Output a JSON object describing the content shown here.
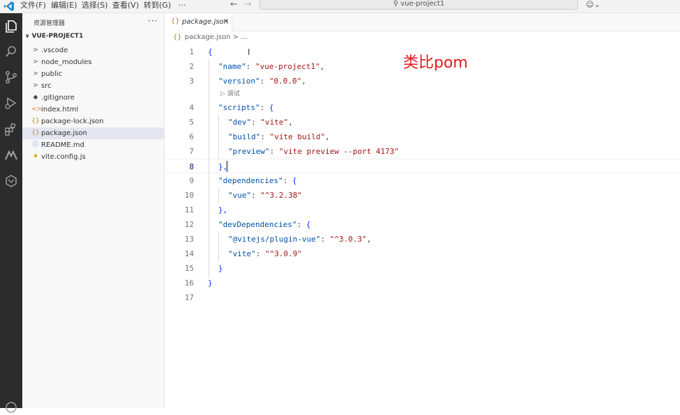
{
  "menu": {
    "items": [
      "文件(F)",
      "编辑(E)",
      "选择(S)",
      "查看(V)",
      "转到(G)",
      "···"
    ]
  },
  "search": {
    "text": "vue-project1"
  },
  "sidebar": {
    "title": "资源管理器",
    "more": "···",
    "project": "VUE-PROJECT1",
    "items": [
      {
        "icon": ">",
        "label": ".vscode"
      },
      {
        "icon": ">",
        "label": "node_modules"
      },
      {
        "icon": ">",
        "label": "public"
      },
      {
        "icon": ">",
        "label": "src"
      },
      {
        "icon": "◆",
        "label": ".gitignore"
      },
      {
        "icon": "<>",
        "label": "index.html"
      },
      {
        "icon": "{}",
        "label": "package-lock.json"
      },
      {
        "icon": "{}",
        "label": "package.json"
      },
      {
        "icon": "ⓘ",
        "label": "README.md"
      },
      {
        "icon": "♦",
        "label": "vite.config.js"
      }
    ]
  },
  "tab": {
    "label": "package.json",
    "icon": "{}",
    "close": "×"
  },
  "breadcrumb": {
    "file": "package.json",
    "rest": "…",
    "sep": ">"
  },
  "editor": {
    "line_numbers": [
      "1",
      "2",
      "3",
      "4",
      "5",
      "6",
      "7",
      "8",
      "9",
      "10",
      "11",
      "12",
      "13",
      "14",
      "15",
      "16",
      "17"
    ],
    "codelens": "调试",
    "lines": {
      "l1": "{",
      "l2_key": "\"name\"",
      "l2_val": "\"vue-project1\"",
      "l3_key": "\"version\"",
      "l3_val": "\"0.0.0\"",
      "l4_key": "\"scripts\"",
      "l4_open": "{",
      "l5_key": "\"dev\"",
      "l5_val": "\"vite\"",
      "l6_key": "\"build\"",
      "l6_val": "\"vite build\"",
      "l7_key": "\"preview\"",
      "l7_val": "\"vite preview --port 4173\"",
      "l8": "},",
      "l9_key": "\"dependencies\"",
      "l9_open": "{",
      "l10_key": "\"vue\"",
      "l10_val": "\"^3.2.38\"",
      "l11": "},",
      "l12_key": "\"devDependencies\"",
      "l12_open": "{",
      "l13_key": "\"@vitejs/plugin-vue\"",
      "l13_val": "\"^3.0.3\"",
      "l14_key": "\"vite\"",
      "l14_val": "\"^3.0.9\"",
      "l15": "}",
      "l16": "}"
    }
  },
  "annotation": "类比pom",
  "colors": {
    "key": "#0451a5",
    "string": "#a31515",
    "annotation": "#e0191b",
    "activity_bar": "#2c2c2c"
  }
}
